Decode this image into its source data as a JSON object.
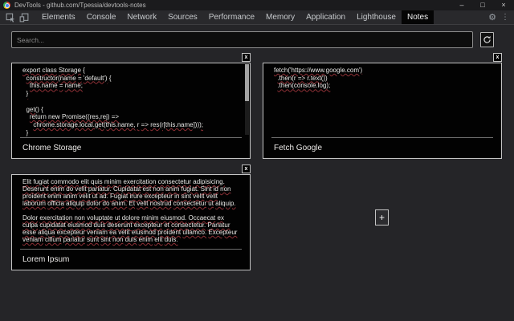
{
  "window": {
    "title": "DevTools - github.com/Tpessia/devtools-notes",
    "minimize": "–",
    "maximize": "□",
    "close": "×"
  },
  "tabbar": {
    "tabs": [
      {
        "label": "Elements",
        "active": false
      },
      {
        "label": "Console",
        "active": false
      },
      {
        "label": "Network",
        "active": false
      },
      {
        "label": "Sources",
        "active": false
      },
      {
        "label": "Performance",
        "active": false
      },
      {
        "label": "Memory",
        "active": false
      },
      {
        "label": "Application",
        "active": false
      },
      {
        "label": "Lighthouse",
        "active": false
      },
      {
        "label": "Notes",
        "active": true
      }
    ],
    "settings_icon": "⚙",
    "menu_icon": "⋮"
  },
  "search": {
    "placeholder": "Search...",
    "value": ""
  },
  "notes": [
    {
      "title": "Chrome Storage",
      "close_label": "x",
      "kind": "code",
      "has_scrollbar": true,
      "lines": [
        "export class Storage {",
        "  constructor(name = 'default') {",
        "    this.name = name;",
        "  }",
        "",
        "  get() {",
        "    return new Promise((res,rej) =>",
        "      chrome.storage.local.get(this.name, r => res(r[this.name])));",
        "  }"
      ]
    },
    {
      "title": "Fetch Google",
      "close_label": "x",
      "kind": "code",
      "has_scrollbar": false,
      "lines": [
        "fetch('https://www.google.com')",
        "  .then(r => r.text())",
        "  .then(console.log);"
      ]
    },
    {
      "title": "Lorem Ipsum",
      "close_label": "x",
      "kind": "text",
      "has_scrollbar": false,
      "paragraphs": [
        "Elit fugiat commodo elit quis minim exercitation consectetur adipisicing. Deserunt enim do velit pariatur. Cupidatat est non anim fugiat. Sint id non proident enim anim velit ut ad. Fugiat irure excepteur in sint velit velit laborum officia aliquip dolor do anim. Et velit nostrud consectetur ut aliquip.",
        "Dolor exercitation non voluptate ut dolore minim eiusmod. Occaecat ex culpa cupidatat eiusmod duis deserunt excepteur et consectetur. Pariatur esse aliqua excepteur veniam ea velit eiusmod proident ullamco. Excepteur veniam cillum pariatur sunt sint non duis enim elit duis."
      ]
    }
  ],
  "add_note_label": "+",
  "colors": {
    "panel_bg": "#252528",
    "titlebar_bg": "#1b1b1d",
    "tabbar_bg": "#29292c",
    "tab_active_bg": "#050505",
    "card_bg": "#020202",
    "card_border": "#c4c4c4",
    "note_text": "#e9e9e7",
    "spellcheck_underline": "#8e3036",
    "divider": "#6e6e6e"
  }
}
